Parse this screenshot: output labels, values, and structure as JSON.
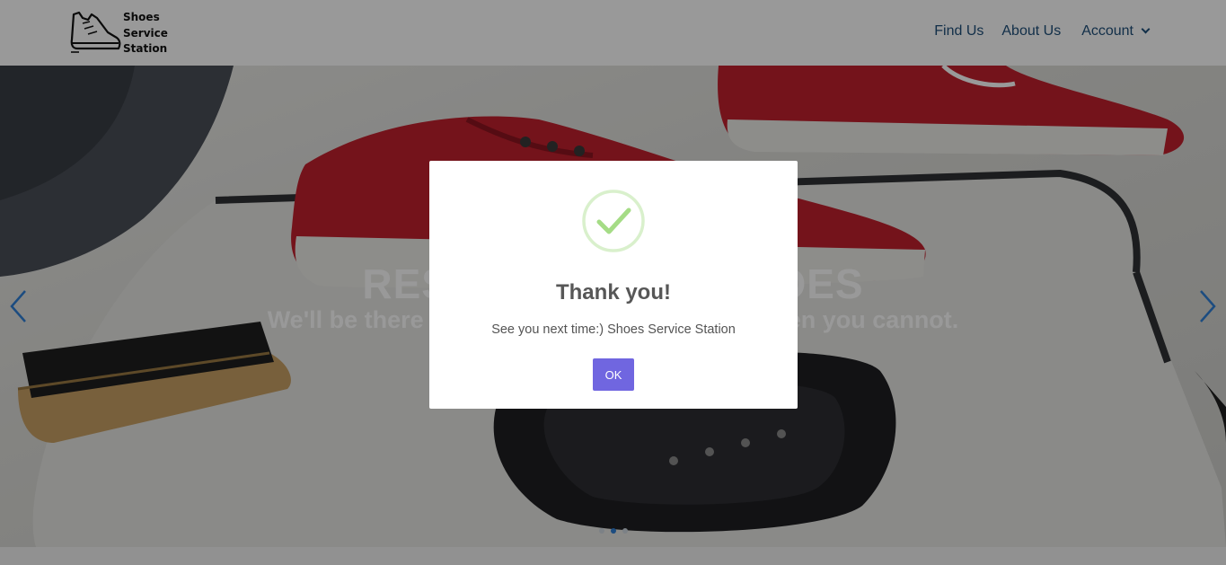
{
  "brand": {
    "logo_lines": [
      "Shoes",
      "Service",
      "Station"
    ],
    "icon": "sneaker-icon"
  },
  "nav": {
    "items": [
      {
        "label": "Find Us"
      },
      {
        "label": "About Us"
      },
      {
        "label": "Account",
        "icon": "chevron-down-icon"
      }
    ]
  },
  "hero": {
    "title": "RESTORE YOUR SHOES",
    "subtitle": "We'll be there to care for your shoes even when you cannot.",
    "prev_icon": "chevron-left-icon",
    "next_icon": "chevron-right-icon",
    "slides_count": 3,
    "active_slide": 2
  },
  "modal": {
    "icon": "check-circle-icon",
    "title": "Thank you!",
    "text": "See you next time:) Shoes Service Station",
    "ok_label": "OK"
  },
  "colors": {
    "nav_link": "#1e4f7a",
    "carousel_arrow": "#2f7fd6",
    "ok_button": "#7066e0",
    "success": "#a5dc86",
    "overlay": "rgba(0,0,0,0.4)"
  }
}
